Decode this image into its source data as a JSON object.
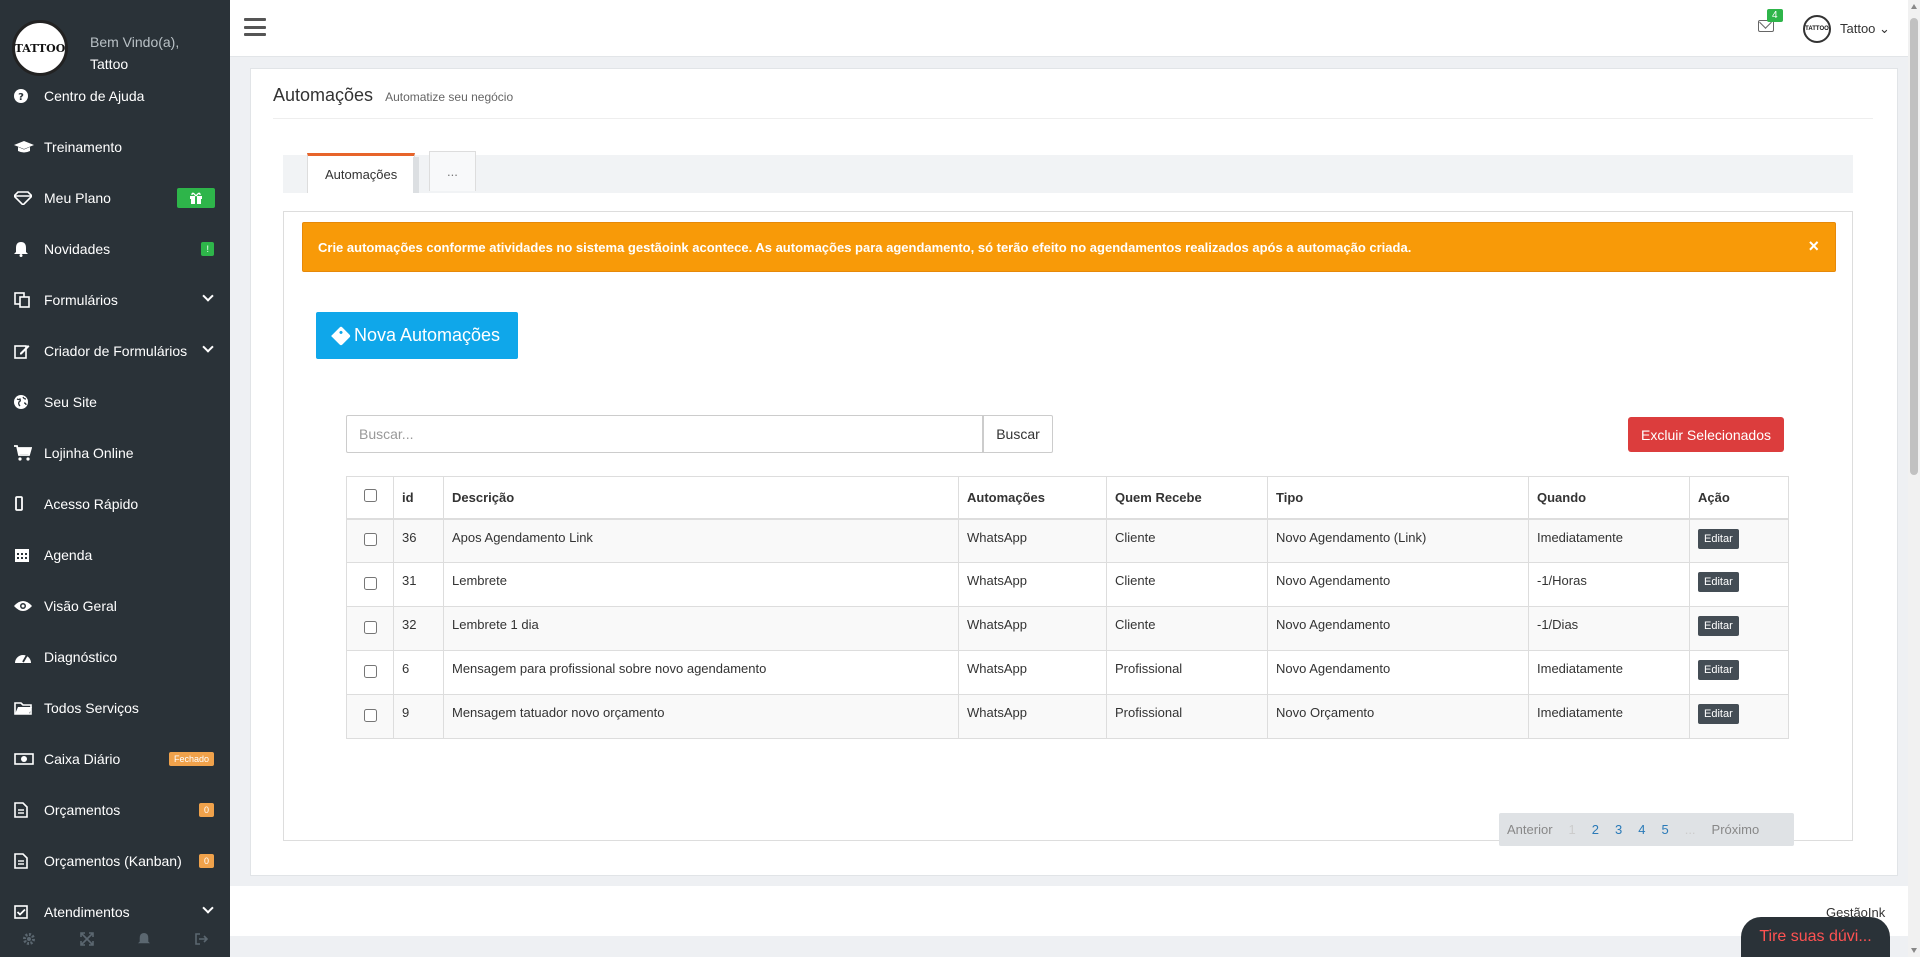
{
  "sidebar": {
    "logo_text": "TATTOO",
    "welcome": "Bem Vindo(a),",
    "user": "Tattoo",
    "items": [
      {
        "label": "Centro de Ajuda",
        "icon": "question-circle-icon"
      },
      {
        "label": "Treinamento",
        "icon": "graduation-cap-icon"
      },
      {
        "label": "Meu Plano",
        "icon": "diamond-icon"
      },
      {
        "label": "Novidades",
        "icon": "bell-icon",
        "badge": "!"
      },
      {
        "label": "Formulários",
        "icon": "documents-icon"
      },
      {
        "label": "Criador de Formulários",
        "icon": "edit-icon"
      },
      {
        "label": "Seu Site",
        "icon": "globe-icon"
      },
      {
        "label": "Lojinha Online",
        "icon": "cart-icon"
      },
      {
        "label": "Acesso Rápido",
        "icon": "mobile-icon"
      },
      {
        "label": "Agenda",
        "icon": "calendar-icon"
      },
      {
        "label": "Visão Geral",
        "icon": "eye-icon"
      },
      {
        "label": "Diagnóstico",
        "icon": "dashboard-icon"
      },
      {
        "label": "Todos Serviços",
        "icon": "folder-icon"
      },
      {
        "label": "Caixa Diário",
        "icon": "money-icon",
        "badge": "Fechado"
      },
      {
        "label": "Orçamentos",
        "icon": "file-icon",
        "badge": "0"
      },
      {
        "label": "Orçamentos (Kanban)",
        "icon": "file-icon",
        "badge": "0"
      },
      {
        "label": "Atendimentos",
        "icon": "check-square-icon"
      }
    ]
  },
  "topbar": {
    "mail_count": "4",
    "user_name": "Tattoo",
    "avatar_text": "TATTOO"
  },
  "page": {
    "title": "Automações",
    "subtitle": "Automatize seu negócio"
  },
  "tabs": [
    {
      "label": "Automações"
    },
    {
      "label": "..."
    }
  ],
  "alert": {
    "text": "Crie automações conforme atividades no sistema gestãoink acontece. As automações para agendamento, só terão efeito no agendamentos realizados após a automação criada.",
    "close": "×"
  },
  "buttons": {
    "new": "Nova Automações",
    "search": "Buscar",
    "delete_selected": "Excluir Selecionados",
    "edit": "Editar"
  },
  "search": {
    "placeholder": "Buscar...",
    "value": ""
  },
  "table": {
    "headers": [
      "id",
      "Descrição",
      "Automações",
      "Quem Recebe",
      "Tipo",
      "Quando",
      "Ação"
    ],
    "rows": [
      {
        "id": "36",
        "descricao": "Apos Agendamento Link",
        "automacoes": "WhatsApp",
        "quem": "Cliente",
        "tipo": "Novo Agendamento (Link)",
        "quando": "Imediatamente"
      },
      {
        "id": "31",
        "descricao": "Lembrete",
        "automacoes": "WhatsApp",
        "quem": "Cliente",
        "tipo": "Novo Agendamento",
        "quando": "-1/Horas"
      },
      {
        "id": "32",
        "descricao": "Lembrete 1 dia",
        "automacoes": "WhatsApp",
        "quem": "Cliente",
        "tipo": "Novo Agendamento",
        "quando": "-1/Dias"
      },
      {
        "id": "6",
        "descricao": "Mensagem para profissional sobre novo agendamento",
        "automacoes": "WhatsApp",
        "quem": "Profissional",
        "tipo": "Novo Agendamento",
        "quando": "Imediatamente"
      },
      {
        "id": "9",
        "descricao": "Mensagem tatuador novo orçamento",
        "automacoes": "WhatsApp",
        "quem": "Profissional",
        "tipo": "Novo Orçamento",
        "quando": "Imediatamente"
      }
    ]
  },
  "pagination": {
    "prev": "Anterior",
    "pages": [
      "1",
      "2",
      "3",
      "4",
      "5"
    ],
    "ellipsis": "...",
    "next": "Próximo"
  },
  "footer": {
    "brand": "GestãoInk",
    "chat": "Tire suas dúvi..."
  },
  "colors": {
    "sidebar_bg": "#2a3238",
    "accent_blue": "#0fa7ea",
    "alert_orange": "#f89a08",
    "danger": "#dc3d3d",
    "success": "#2eb54a"
  }
}
